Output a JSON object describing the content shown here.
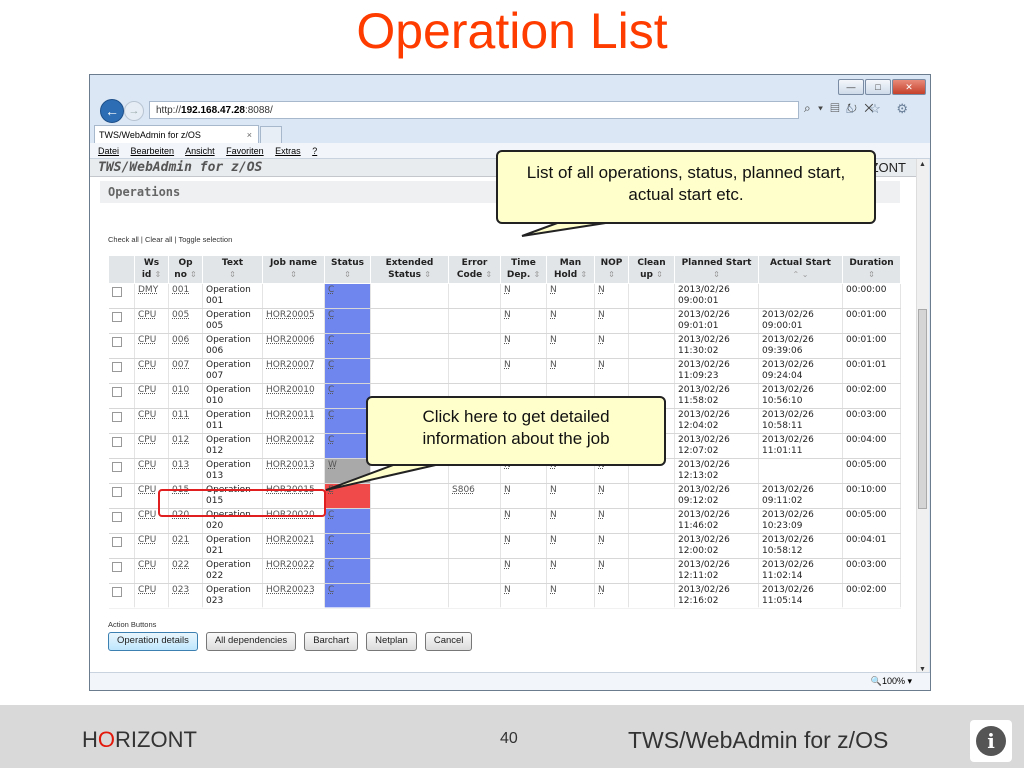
{
  "slide": {
    "title": "Operation List",
    "footer_brand_pre": "H",
    "footer_brand_o": "O",
    "footer_brand_post": "RIZONT",
    "page_number": "40",
    "footer_product": "TWS/WebAdmin for z/OS",
    "info_glyph": "i"
  },
  "browser": {
    "url_prefix": "http://",
    "url_host": "192.168.47.28",
    "url_port": ":8088/",
    "url_tools": "⌕ ▾ ▤ ↻ ✕",
    "toolbar_icons": "⌂ ☆ ⚙",
    "tab_title": "TWS/WebAdmin for z/OS",
    "tab_close": "×",
    "menu": [
      "Datei",
      "Bearbeiten",
      "Ansicht",
      "Favoriten",
      "Extras",
      "?"
    ],
    "zoom": "🔍100%  ▾",
    "win_min": "—",
    "win_max": "□",
    "win_close": "✕"
  },
  "app": {
    "header_title": "TWS/WebAdmin for z/OS",
    "header_brand": "ZONT",
    "panel_title": "Operations",
    "check_links": "Check all | Clear all | Toggle selection",
    "action_label": "Action Buttons",
    "buttons": {
      "operation_details": "Operation details",
      "all_dependencies": "All dependencies",
      "barchart": "Barchart",
      "netplan": "Netplan",
      "cancel": "Cancel"
    }
  },
  "table": {
    "headers": [
      {
        "l1": "",
        "l2": "",
        "sort": ""
      },
      {
        "l1": "Ws",
        "l2": "id",
        "sort": "⇕"
      },
      {
        "l1": "Op",
        "l2": "no",
        "sort": "⇕"
      },
      {
        "l1": "Text",
        "l2": "",
        "sort": "⇕"
      },
      {
        "l1": "Job name",
        "l2": "",
        "sort": "⇕"
      },
      {
        "l1": "Status",
        "l2": "",
        "sort": "⇕"
      },
      {
        "l1": "Extended",
        "l2": "Status",
        "sort": "⇕"
      },
      {
        "l1": "Error",
        "l2": "Code",
        "sort": "⇕"
      },
      {
        "l1": "Time",
        "l2": "Dep.",
        "sort": "⇕"
      },
      {
        "l1": "Man",
        "l2": "Hold",
        "sort": "⇕"
      },
      {
        "l1": "NOP",
        "l2": "",
        "sort": "⇕"
      },
      {
        "l1": "Clean",
        "l2": "up",
        "sort": "⇕"
      },
      {
        "l1": "Planned Start",
        "l2": "",
        "sort": "⇕"
      },
      {
        "l1": "Actual Start",
        "l2": "",
        "sort": "⌃ ⌄"
      },
      {
        "l1": "Duration",
        "l2": "",
        "sort": "⇕"
      }
    ],
    "rows": [
      {
        "ws": "DMY",
        "op": "001",
        "text1": "Operation",
        "text2": "001",
        "job": "",
        "status": "C",
        "ext": "",
        "err": "",
        "time": "N",
        "hold": "N",
        "nop": "N",
        "clean": "",
        "plan1": "2013/02/26",
        "plan2": "09:00:01",
        "act1": "",
        "act2": "",
        "dur": "00:00:00"
      },
      {
        "ws": "CPU",
        "op": "005",
        "text1": "Operation",
        "text2": "005",
        "job": "HOR20005",
        "status": "C",
        "ext": "",
        "err": "",
        "time": "N",
        "hold": "N",
        "nop": "N",
        "clean": "",
        "plan1": "2013/02/26",
        "plan2": "09:01:01",
        "act1": "2013/02/26",
        "act2": "09:00:01",
        "dur": "00:01:00"
      },
      {
        "ws": "CPU",
        "op": "006",
        "text1": "Operation",
        "text2": "006",
        "job": "HOR20006",
        "status": "C",
        "ext": "",
        "err": "",
        "time": "N",
        "hold": "N",
        "nop": "N",
        "clean": "",
        "plan1": "2013/02/26",
        "plan2": "11:30:02",
        "act1": "2013/02/26",
        "act2": "09:39:06",
        "dur": "00:01:00"
      },
      {
        "ws": "CPU",
        "op": "007",
        "text1": "Operation",
        "text2": "007",
        "job": "HOR20007",
        "status": "C",
        "ext": "",
        "err": "",
        "time": "N",
        "hold": "N",
        "nop": "N",
        "clean": "",
        "plan1": "2013/02/26",
        "plan2": "11:09:23",
        "act1": "2013/02/26",
        "act2": "09:24:04",
        "dur": "00:01:01"
      },
      {
        "ws": "CPU",
        "op": "010",
        "text1": "Operation",
        "text2": "010",
        "job": "HOR20010",
        "status": "C",
        "ext": "",
        "err": "",
        "time": "",
        "hold": "",
        "nop": "",
        "clean": "",
        "plan1": "2013/02/26",
        "plan2": "11:58:02",
        "act1": "2013/02/26",
        "act2": "10:56:10",
        "dur": "00:02:00"
      },
      {
        "ws": "CPU",
        "op": "011",
        "text1": "Operation",
        "text2": "011",
        "job": "HOR20011",
        "status": "C",
        "ext": "",
        "err": "",
        "time": "",
        "hold": "",
        "nop": "",
        "clean": "",
        "plan1": "2013/02/26",
        "plan2": "12:04:02",
        "act1": "2013/02/26",
        "act2": "10:58:11",
        "dur": "00:03:00"
      },
      {
        "ws": "CPU",
        "op": "012",
        "text1": "Operation",
        "text2": "012",
        "job": "HOR20012",
        "status": "C",
        "ext": "",
        "err": "",
        "time": "",
        "hold": "",
        "nop": "",
        "clean": "",
        "plan1": "2013/02/26",
        "plan2": "12:07:02",
        "act1": "2013/02/26",
        "act2": "11:01:11",
        "dur": "00:04:00"
      },
      {
        "ws": "CPU",
        "op": "013",
        "text1": "Operation",
        "text2": "013",
        "job": "HOR20013",
        "status": "W",
        "ext": "",
        "err": "",
        "time": "N",
        "hold": "N",
        "nop": "N",
        "clean": "",
        "plan1": "2013/02/26",
        "plan2": "12:13:02",
        "act1": "",
        "act2": "",
        "dur": "00:05:00"
      },
      {
        "ws": "CPU",
        "op": "015",
        "text1": "Operation",
        "text2": "015",
        "job": "HOR20015",
        "status": "E",
        "ext": "",
        "err": "S806",
        "time": "N",
        "hold": "N",
        "nop": "N",
        "clean": "",
        "plan1": "2013/02/26",
        "plan2": "09:12:02",
        "act1": "2013/02/26",
        "act2": "09:11:02",
        "dur": "00:10:00"
      },
      {
        "ws": "CPU",
        "op": "020",
        "text1": "Operation",
        "text2": "020",
        "job": "HOR20020",
        "status": "C",
        "ext": "",
        "err": "",
        "time": "N",
        "hold": "N",
        "nop": "N",
        "clean": "",
        "plan1": "2013/02/26",
        "plan2": "11:46:02",
        "act1": "2013/02/26",
        "act2": "10:23:09",
        "dur": "00:05:00"
      },
      {
        "ws": "CPU",
        "op": "021",
        "text1": "Operation",
        "text2": "021",
        "job": "HOR20021",
        "status": "C",
        "ext": "",
        "err": "",
        "time": "N",
        "hold": "N",
        "nop": "N",
        "clean": "",
        "plan1": "2013/02/26",
        "plan2": "12:00:02",
        "act1": "2013/02/26",
        "act2": "10:58:12",
        "dur": "00:04:01"
      },
      {
        "ws": "CPU",
        "op": "022",
        "text1": "Operation",
        "text2": "022",
        "job": "HOR20022",
        "status": "C",
        "ext": "",
        "err": "",
        "time": "N",
        "hold": "N",
        "nop": "N",
        "clean": "",
        "plan1": "2013/02/26",
        "plan2": "12:11:02",
        "act1": "2013/02/26",
        "act2": "11:02:14",
        "dur": "00:03:00"
      },
      {
        "ws": "CPU",
        "op": "023",
        "text1": "Operation",
        "text2": "023",
        "job": "HOR20023",
        "status": "C",
        "ext": "",
        "err": "",
        "time": "N",
        "hold": "N",
        "nop": "N",
        "clean": "",
        "plan1": "2013/02/26",
        "plan2": "12:16:02",
        "act1": "2013/02/26",
        "act2": "11:05:14",
        "dur": "00:02:00"
      }
    ]
  },
  "callouts": {
    "list_text": "List of all operations, status, planned start, actual start etc.",
    "detail_text": "Click here to get detailed information about the job"
  },
  "colors": {
    "status_C": "#6f86ee",
    "status_W": "#a9a9a9",
    "status_E": "#f04a4a",
    "title_orange": "#ff3c00",
    "callout_bg": "#ffffcc"
  }
}
